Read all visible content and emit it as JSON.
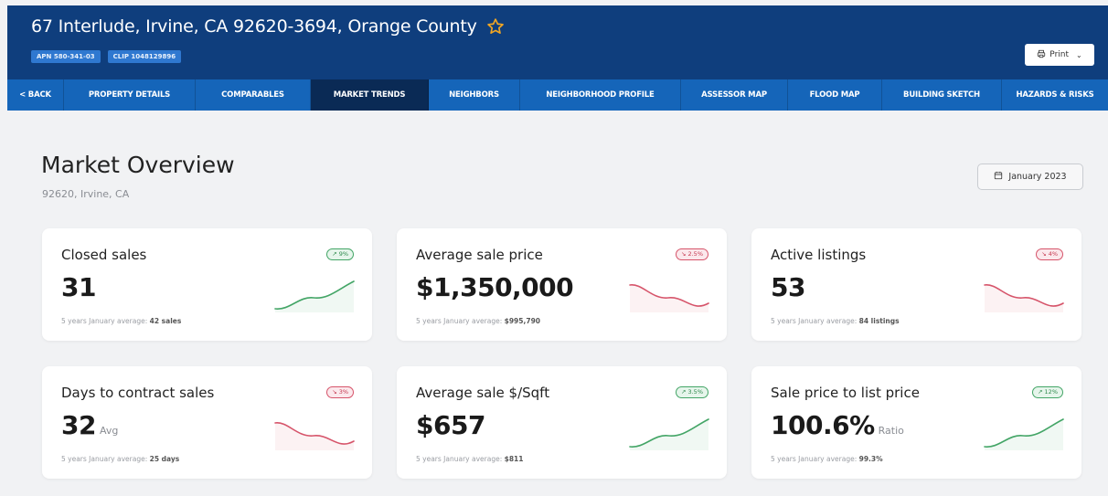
{
  "header": {
    "address": "67 Interlude, Irvine, CA 92620-3694, Orange County",
    "chips": [
      "APN 580-341-03",
      "CLIP 1048129896"
    ],
    "print_label": "Print"
  },
  "nav": {
    "items": [
      {
        "label": "< BACK",
        "active": false
      },
      {
        "label": "PROPERTY DETAILS",
        "active": false
      },
      {
        "label": "COMPARABLES",
        "active": false
      },
      {
        "label": "MARKET TRENDS",
        "active": true
      },
      {
        "label": "NEIGHBORS",
        "active": false
      },
      {
        "label": "NEIGHBORHOOD PROFILE",
        "active": false
      },
      {
        "label": "ASSESSOR MAP",
        "active": false
      },
      {
        "label": "FLOOD MAP",
        "active": false
      },
      {
        "label": "BUILDING SKETCH",
        "active": false
      },
      {
        "label": "HAZARDS & RISKS",
        "active": false
      }
    ]
  },
  "overview": {
    "title": "Market Overview",
    "subtitle": "92620, Irvine, CA",
    "date_label": "January 2023"
  },
  "cards": [
    {
      "title": "Closed sales",
      "value": "31",
      "unit": "",
      "badge": "9%",
      "trend": "up",
      "foot_prefix": "5 years January average:",
      "foot_value": "42 sales"
    },
    {
      "title": "Average sale price",
      "value": "$1,350,000",
      "unit": "",
      "badge": "2.5%",
      "trend": "down",
      "foot_prefix": "5 years January average:",
      "foot_value": "$995,790"
    },
    {
      "title": "Active listings",
      "value": "53",
      "unit": "",
      "badge": "4%",
      "trend": "down",
      "foot_prefix": "5 years January average:",
      "foot_value": "84 listings"
    },
    {
      "title": "Days to contract sales",
      "value": "32",
      "unit": "Avg",
      "badge": "3%",
      "trend": "down",
      "foot_prefix": "5 years January average:",
      "foot_value": "25 days"
    },
    {
      "title": "Average sale $/Sqft",
      "value": "$657",
      "unit": "",
      "badge": "3.5%",
      "trend": "up",
      "foot_prefix": "5 years January average:",
      "foot_value": "$811"
    },
    {
      "title": "Sale price to list price",
      "value": "100.6%",
      "unit": "Ratio",
      "badge": "12%",
      "trend": "up",
      "foot_prefix": "5 years January average:",
      "foot_value": "99.3%"
    }
  ],
  "colors": {
    "header_bg": "#0f3e7d",
    "nav_bg": "#1565b9",
    "nav_active": "#0a2a55",
    "up": "#43a566",
    "down": "#d6546a",
    "star": "#f2a623"
  },
  "icons": {
    "favorite": "star-icon",
    "print": "printer-icon",
    "calendar": "calendar-icon"
  }
}
